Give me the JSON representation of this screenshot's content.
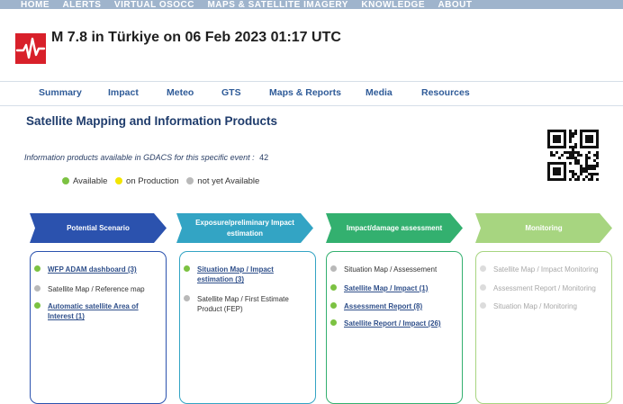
{
  "top_nav": {
    "items": [
      "HOME",
      "ALERTS",
      "VIRTUAL OSOCC",
      "MAPS & SATELLITE IMAGERY",
      "KNOWLEDGE",
      "ABOUT"
    ]
  },
  "header": {
    "title": "M 7.8 in Türkiye on 06 Feb 2023 01:17 UTC",
    "logo_color": "#d8202a"
  },
  "tabs": [
    "Summary",
    "Impact",
    "Meteo",
    "GTS",
    "Maps & Reports",
    "Media",
    "Resources"
  ],
  "section": {
    "title": "Satellite Mapping and Information Products",
    "info_text": "Information products available in GDACS for this specific event :",
    "info_count": "42"
  },
  "legend": [
    {
      "label": "Available",
      "color": "#7cc242"
    },
    {
      "label": "on Production",
      "color": "#f2e500"
    },
    {
      "label": "not yet Available",
      "color": "#b9b9b9"
    }
  ],
  "columns": [
    {
      "title": "Potential Scenario",
      "color": "#2b52ae",
      "items": [
        {
          "text": "WFP ADAM dashboard (3)",
          "status": "available",
          "link": true
        },
        {
          "text": "Satellite Map / Reference map",
          "status": "none",
          "link": false
        },
        {
          "text": "Automatic satellite Area of Interest (1)",
          "status": "available",
          "link": true
        }
      ]
    },
    {
      "title": "Exposure/preliminary Impact estimation",
      "color": "#33a4c4",
      "items": [
        {
          "text": "Situation Map / Impact estimation (3)",
          "status": "available",
          "link": true
        },
        {
          "text": "Satellite Map / First Estimate Product (FEP)",
          "status": "none",
          "link": false
        }
      ]
    },
    {
      "title": "Impact/damage assessment",
      "color": "#33b06f",
      "items": [
        {
          "text": "Situation Map / Assessement",
          "status": "none",
          "link": false
        },
        {
          "text": "Satellite Map / Impact (1)",
          "status": "available",
          "link": true
        },
        {
          "text": "Assessment Report (8)",
          "status": "available",
          "link": true
        },
        {
          "text": "Satellite Report / Impact (26)",
          "status": "available",
          "link": true
        }
      ]
    },
    {
      "title": "Monitoring",
      "color": "#a7d580",
      "items": [
        {
          "text": "Satellite Map / Impact Monitoring",
          "status": "none",
          "link": false
        },
        {
          "text": "Assessment Report / Monitoring",
          "status": "none",
          "link": false
        },
        {
          "text": "Situation Map / Monitoring",
          "status": "none",
          "link": false
        }
      ]
    }
  ]
}
